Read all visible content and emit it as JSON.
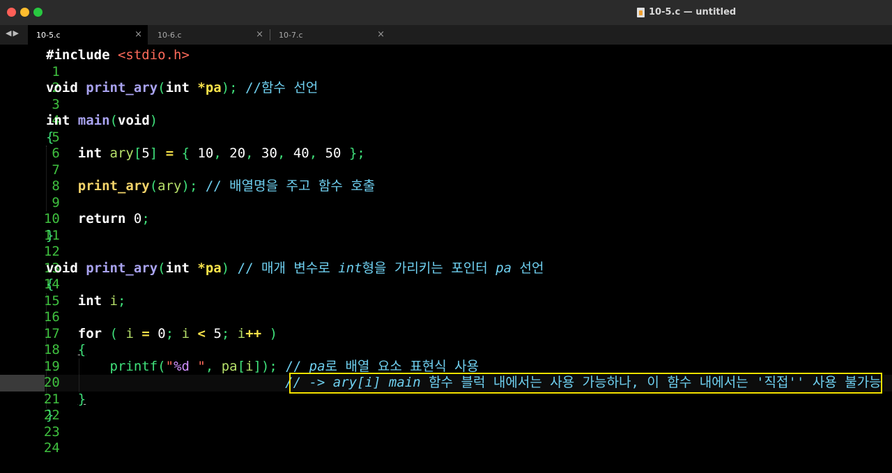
{
  "window": {
    "title": "10-5.c — untitled"
  },
  "tabs": [
    {
      "label": "10-5.c",
      "active": true
    },
    {
      "label": "10-6.c",
      "active": false
    },
    {
      "label": "10-7.c",
      "active": false
    }
  ],
  "nav": {
    "back": "◀",
    "forward": "▶"
  },
  "icons": {
    "close": "×"
  },
  "line_numbers": [
    "1",
    "2",
    "3",
    "4",
    "5",
    "6",
    "7",
    "8",
    "9",
    "10",
    "11",
    "12",
    "13",
    "14",
    "15",
    "16",
    "17",
    "18",
    "19",
    "20",
    "21",
    "22",
    "23",
    "24"
  ],
  "current_line": "21",
  "code": {
    "l1": [
      "#include",
      " ",
      "<stdio.h>"
    ],
    "l3": [
      "void",
      " ",
      "print_ary",
      "(",
      "int",
      " ",
      "*pa",
      ");",
      " ",
      "//함수 선언"
    ],
    "l5": [
      "int",
      " ",
      "main",
      "(",
      "void",
      ")"
    ],
    "l6": [
      "{"
    ],
    "l7": [
      "    ",
      "int",
      " ",
      "ary",
      "[",
      "5",
      "]",
      " ",
      "=",
      " ",
      "{",
      " 10",
      ",",
      " 20",
      ",",
      " 30",
      ",",
      " 40",
      ",",
      " 50",
      " ",
      "}",
      ";"
    ],
    "l9": [
      "    ",
      "print_ary",
      "(",
      "ary",
      ");",
      " ",
      "// 배열명을 주고 함수 호출"
    ],
    "l11": [
      "    ",
      "return",
      " ",
      "0",
      ";"
    ],
    "l12": [
      "}"
    ],
    "l14": [
      "void",
      " ",
      "print_ary",
      "(",
      "int",
      " ",
      "*pa",
      ")",
      " ",
      "// 매개 변수로 ",
      "int",
      "형을 가리키는 포인터 ",
      "pa",
      " 선언"
    ],
    "l15": [
      "{"
    ],
    "l16": [
      "    ",
      "int",
      " ",
      "i",
      ";"
    ],
    "l18": [
      "    ",
      "for",
      " ",
      "(",
      " ",
      "i",
      " ",
      "=",
      " ",
      "0",
      ";",
      " ",
      "i",
      " ",
      "<",
      " ",
      "5",
      ";",
      " ",
      "i",
      "++",
      " ",
      ")"
    ],
    "l19": [
      "    ",
      "{"
    ],
    "l20": [
      "        ",
      "printf",
      "(",
      "\"",
      "%d",
      " \"",
      ", ",
      "pa",
      "[",
      "i",
      "]",
      ");",
      " ",
      "// ",
      "pa",
      "로 배열 요소 표현식 사용"
    ],
    "l21": [
      "                              ",
      "// -> ary[i] main",
      " 함수 블럭 내에서는 사용 가능하나, 이 함수 내에서는 '직접'' 사용 불가능"
    ],
    "l22": [
      "    ",
      "}"
    ],
    "l23": [
      "}"
    ]
  },
  "colors": {
    "background": "#000000",
    "line_number": "#3fc03f",
    "keyword": "#ffffff",
    "function": "#a9a3f0",
    "comment": "#6fd0f0",
    "string": "#ff6a5a",
    "operator": "#f7e24a",
    "highlight_box": "#f5e200"
  }
}
